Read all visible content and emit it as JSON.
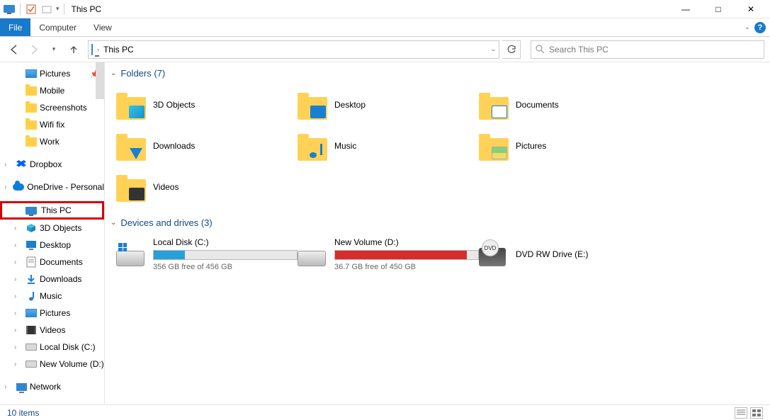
{
  "window": {
    "title": "This PC",
    "min": "—",
    "max": "□",
    "close": "✕"
  },
  "ribbon": {
    "file": "File",
    "computer": "Computer",
    "view": "View"
  },
  "nav": {
    "breadcrumb_icon": "monitor",
    "breadcrumb": "This PC",
    "search_placeholder": "Search This PC"
  },
  "sidebar": {
    "items": [
      {
        "label": "Pictures",
        "kind": "pic",
        "level": 1,
        "exp": false,
        "pin": true
      },
      {
        "label": "Mobile",
        "kind": "folder",
        "level": 1,
        "exp": false
      },
      {
        "label": "Screenshots",
        "kind": "folder",
        "level": 1,
        "exp": false
      },
      {
        "label": "Wifi fix",
        "kind": "folder",
        "level": 1,
        "exp": false
      },
      {
        "label": "Work",
        "kind": "folder",
        "level": 1,
        "exp": false
      },
      {
        "spacer": true
      },
      {
        "label": "Dropbox",
        "kind": "dropbox",
        "level": 0,
        "exp": true
      },
      {
        "spacer": true
      },
      {
        "label": "OneDrive - Personal",
        "kind": "cloud",
        "level": 0,
        "exp": true
      },
      {
        "spacer": true
      },
      {
        "label": "This PC",
        "kind": "monitor",
        "level": 0,
        "exp": false,
        "highlight": true,
        "selected": true
      },
      {
        "label": "3D Objects",
        "kind": "cube",
        "level": 1,
        "exp": true
      },
      {
        "label": "Desktop",
        "kind": "screen",
        "level": 1,
        "exp": true
      },
      {
        "label": "Documents",
        "kind": "doc",
        "level": 1,
        "exp": true
      },
      {
        "label": "Downloads",
        "kind": "down",
        "level": 1,
        "exp": true
      },
      {
        "label": "Music",
        "kind": "music",
        "level": 1,
        "exp": true
      },
      {
        "label": "Pictures",
        "kind": "pic",
        "level": 1,
        "exp": true
      },
      {
        "label": "Videos",
        "kind": "film",
        "level": 1,
        "exp": true
      },
      {
        "label": "Local Disk (C:)",
        "kind": "drive",
        "level": 1,
        "exp": true
      },
      {
        "label": "New Volume (D:)",
        "kind": "drive",
        "level": 1,
        "exp": true
      },
      {
        "spacer": true
      },
      {
        "label": "Network",
        "kind": "net",
        "level": 0,
        "exp": true
      }
    ]
  },
  "sections": {
    "folders_label": "Folders (7)",
    "drives_label": "Devices and drives (3)"
  },
  "folders": [
    {
      "name": "3D Objects",
      "overlay": "cube"
    },
    {
      "name": "Desktop",
      "overlay": "screen"
    },
    {
      "name": "Documents",
      "overlay": "note"
    },
    {
      "name": "Downloads",
      "overlay": "down"
    },
    {
      "name": "Music",
      "overlay": "music"
    },
    {
      "name": "Pictures",
      "overlay": "pic"
    },
    {
      "name": "Videos",
      "overlay": "film"
    }
  ],
  "drives": [
    {
      "name": "Local Disk (C:)",
      "free": "356 GB free of 456 GB",
      "fill_pct": 22,
      "color": "blue",
      "type": "hdd",
      "os": true
    },
    {
      "name": "New Volume (D:)",
      "free": "36.7 GB free of 450 GB",
      "fill_pct": 92,
      "color": "red",
      "type": "hdd",
      "os": false
    },
    {
      "name": "DVD RW Drive (E:)",
      "free": "",
      "fill_pct": 0,
      "color": "",
      "type": "dvd",
      "os": false
    }
  ],
  "status": {
    "text": "10 items"
  }
}
